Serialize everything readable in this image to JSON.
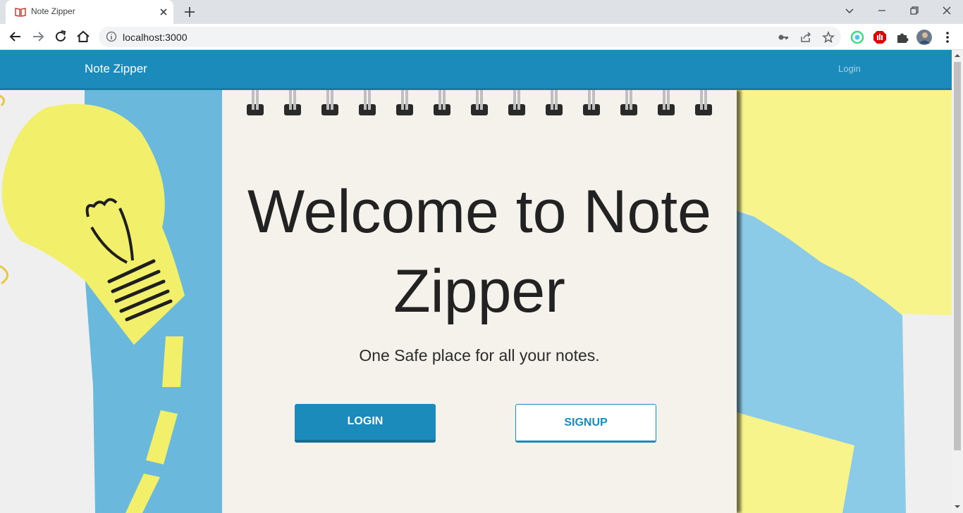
{
  "browser": {
    "tab_title": "Note Zipper",
    "url": "localhost:3000"
  },
  "navbar": {
    "brand": "Note Zipper",
    "login_link": "Login"
  },
  "hero": {
    "heading": "Welcome to Note Zipper",
    "tagline": "One Safe place for all your notes.",
    "login_button": "LOGIN",
    "signup_button": "SIGNUP"
  },
  "colors": {
    "navbar": "#1a8bbb",
    "accent": "#1a8bbb",
    "sticky_yellow": "#f6f47a",
    "paper_blue": "#6ab8dc"
  },
  "icons": [
    "notebook-favicon-icon",
    "close-icon",
    "plus-icon",
    "minimize-icon",
    "restore-icon",
    "back-arrow-icon",
    "forward-arrow-icon",
    "reload-icon",
    "home-icon",
    "info-icon",
    "key-icon",
    "share-icon",
    "star-icon",
    "extension-icon",
    "adblock-icon",
    "puzzle-icon",
    "avatar",
    "kebab-menu-icon"
  ]
}
